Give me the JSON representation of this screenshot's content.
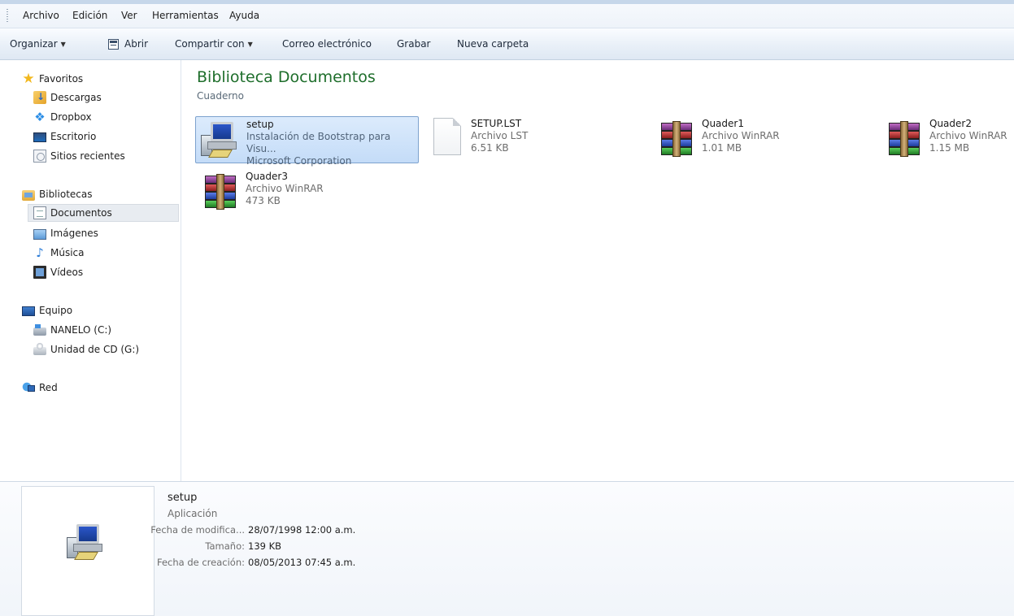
{
  "menu": [
    "Archivo",
    "Edición",
    "Ver",
    "Herramientas",
    "Ayuda"
  ],
  "toolbar": {
    "organize": "Organizar",
    "open": "Abrir",
    "share": "Compartir con",
    "email": "Correo electrónico",
    "burn": "Grabar",
    "new_folder": "Nueva carpeta"
  },
  "nav": {
    "favorites": "Favoritos",
    "downloads": "Descargas",
    "dropbox": "Dropbox",
    "desktop": "Escritorio",
    "recent": "Sitios recientes",
    "libraries": "Bibliotecas",
    "documents": "Documentos",
    "images": "Imágenes",
    "music": "Música",
    "videos": "Vídeos",
    "computer": "Equipo",
    "drive_c": "NANELO (C:)",
    "drive_g": "Unidad de CD (G:)",
    "network": "Red"
  },
  "content": {
    "title": "Biblioteca Documentos",
    "subtitle": "Cuaderno",
    "files": [
      {
        "name": "setup",
        "line2": "Instalación de Bootstrap para Visu...",
        "line3": "Microsoft Corporation",
        "icon": "setup-icon"
      },
      {
        "name": "SETUP.LST",
        "line2": "Archivo LST",
        "line3": "6.51 KB",
        "icon": "document-file-icon"
      },
      {
        "name": "Quader1",
        "line2": "Archivo WinRAR",
        "line3": "1.01 MB",
        "icon": "winrar-archive-icon"
      },
      {
        "name": "Quader2",
        "line2": "Archivo WinRAR",
        "line3": "1.15 MB",
        "icon": "winrar-archive-icon"
      },
      {
        "name": "Quader3",
        "line2": "Archivo WinRAR",
        "line3": "473 KB",
        "icon": "winrar-archive-icon"
      }
    ]
  },
  "details": {
    "name": "setup",
    "type": "Aplicación",
    "modified_label": "Fecha de modifica...",
    "modified_value": "28/07/1998 12:00 a.m.",
    "size_label": "Tamaño:",
    "size_value": "139 KB",
    "created_label": "Fecha de creación:",
    "created_value": "08/05/2013 07:45 a.m."
  }
}
